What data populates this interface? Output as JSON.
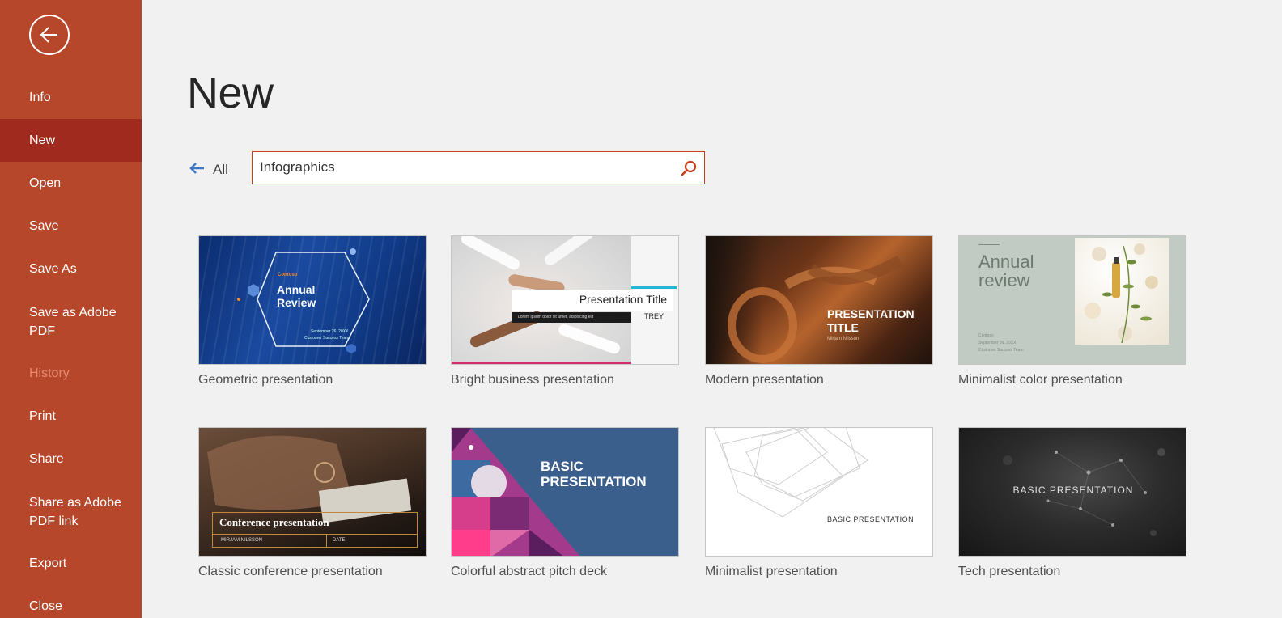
{
  "sidebar": {
    "back_icon": "back-arrow-icon",
    "items": [
      {
        "label": "Info"
      },
      {
        "label": "New"
      },
      {
        "label": "Open"
      },
      {
        "label": "Save"
      },
      {
        "label": "Save As"
      },
      {
        "label": "Save as Adobe PDF"
      },
      {
        "label": "History"
      },
      {
        "label": "Print"
      },
      {
        "label": "Share"
      },
      {
        "label": "Share as Adobe PDF link"
      },
      {
        "label": "Export"
      },
      {
        "label": "Close"
      }
    ],
    "active_item": "New",
    "disabled_item": "History",
    "colors": {
      "background": "#b7472a",
      "active": "#9f2a1d",
      "disabled_text": "#e98a72"
    }
  },
  "main": {
    "title": "New",
    "back_all_label": "All",
    "search": {
      "value": "Infographics",
      "icon": "search-icon"
    },
    "templates": [
      {
        "label": "Geometric presentation",
        "thumb": {
          "kicker": "Contoso",
          "title_line1": "Annual",
          "title_line2": "Review",
          "date": "September 26, 20XX",
          "team": "Customer Success Team"
        }
      },
      {
        "label": "Bright business presentation",
        "thumb": {
          "title": "Presentation Title",
          "subtitle": "Lorem ipsum dolor sit amet, adipiscing elit",
          "name": "TREY"
        }
      },
      {
        "label": "Modern presentation",
        "thumb": {
          "title_line1": "PRESENTATION",
          "title_line2": "TITLE",
          "name": "Mirjam Nilsson"
        }
      },
      {
        "label": "Minimalist color presentation",
        "thumb": {
          "title_line1": "Annual",
          "title_line2": "review",
          "company": "Contoso",
          "date": "September 26, 20XX",
          "team": "Customer Success Team"
        }
      },
      {
        "label": "Classic conference presentation",
        "thumb": {
          "title": "Conference presentation",
          "name": "MIRJAM NILSSON",
          "date": "DATE"
        }
      },
      {
        "label": "Colorful abstract pitch deck",
        "thumb": {
          "title_line1": "BASIC",
          "title_line2": "PRESENTATION"
        }
      },
      {
        "label": "Minimalist presentation",
        "thumb": {
          "title": "BASIC PRESENTATION"
        }
      },
      {
        "label": "Tech presentation",
        "thumb": {
          "title": "BASIC PRESENTATION"
        }
      }
    ]
  }
}
